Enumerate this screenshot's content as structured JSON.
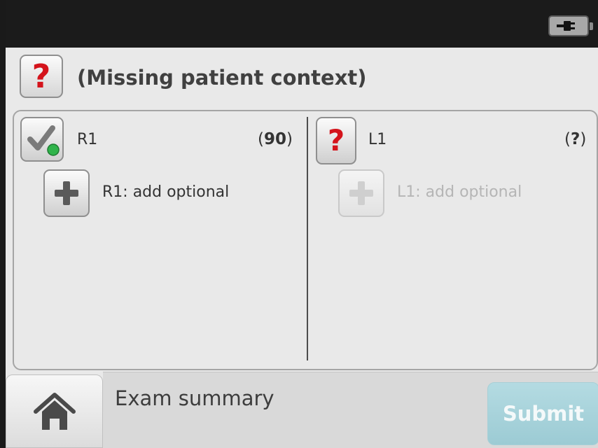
{
  "context": {
    "icon": "question-icon",
    "title": "(Missing patient context)"
  },
  "status_bar": {
    "icon": "battery-plug-icon"
  },
  "right_side": {
    "status_icon": "check-icon",
    "name": "R1",
    "value_open": "(",
    "value": "90",
    "value_close": ")",
    "add_label": "R1: add optional",
    "add_icon": "plus-icon"
  },
  "left_side": {
    "status_icon": "question-icon",
    "name": "L1",
    "value_open": "(",
    "value": "?",
    "value_close": ")",
    "add_label": "L1: add optional",
    "add_icon": "plus-icon"
  },
  "bottom": {
    "home_icon": "home-icon",
    "summary_label": "Exam summary",
    "submit_label": "Submit"
  },
  "colors": {
    "question": "#d4141c",
    "check_dot": "#2fb34a",
    "submit": "#a9d3db"
  }
}
